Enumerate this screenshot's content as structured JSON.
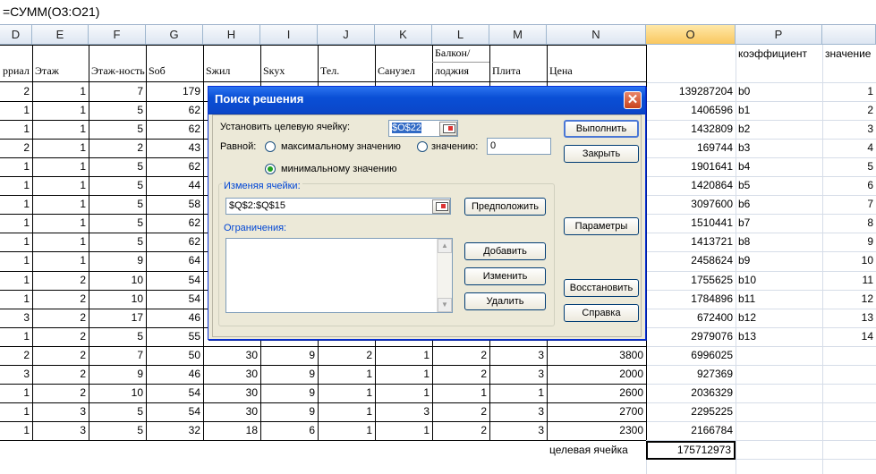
{
  "formula_bar": {
    "text": "=СУММ(O3:O21)"
  },
  "column_headers": [
    "D",
    "E",
    "F",
    "G",
    "H",
    "I",
    "J",
    "K",
    "L",
    "M",
    "N",
    "O",
    "P",
    ""
  ],
  "row1": {
    "D": "рриал с",
    "E": "Этаж",
    "F": "Этаж-ность",
    "G": "Sоб",
    "H": "Sжил",
    "I": "Sкух",
    "J": "Тел.",
    "K": "Санузел",
    "L1": "Балкон/",
    "L2": "лоджия",
    "M": "Плита",
    "N": "Цена",
    "P": "коэффициент",
    "Q": "значение"
  },
  "rows": [
    {
      "D": "2",
      "E": "1",
      "F": "7",
      "G": "179",
      "O": "139287204",
      "P": "b0",
      "Q": "1"
    },
    {
      "D": "1",
      "E": "1",
      "F": "5",
      "G": "62",
      "O": "1406596",
      "P": "b1",
      "Q": "2"
    },
    {
      "D": "1",
      "E": "1",
      "F": "5",
      "G": "62",
      "O": "1432809",
      "P": "b2",
      "Q": "3"
    },
    {
      "D": "2",
      "E": "1",
      "F": "2",
      "G": "43",
      "O": "169744",
      "P": "b3",
      "Q": "4"
    },
    {
      "D": "1",
      "E": "1",
      "F": "5",
      "G": "62",
      "O": "1901641",
      "P": "b4",
      "Q": "5"
    },
    {
      "D": "1",
      "E": "1",
      "F": "5",
      "G": "44",
      "O": "1420864",
      "P": "b5",
      "Q": "6"
    },
    {
      "D": "1",
      "E": "1",
      "F": "5",
      "G": "58",
      "O": "3097600",
      "P": "b6",
      "Q": "7"
    },
    {
      "D": "1",
      "E": "1",
      "F": "5",
      "G": "62",
      "O": "1510441",
      "P": "b7",
      "Q": "8"
    },
    {
      "D": "1",
      "E": "1",
      "F": "5",
      "G": "62",
      "O": "1413721",
      "P": "b8",
      "Q": "9"
    },
    {
      "D": "1",
      "E": "1",
      "F": "9",
      "G": "64",
      "O": "2458624",
      "P": "b9",
      "Q": "10"
    },
    {
      "D": "1",
      "E": "2",
      "F": "10",
      "G": "54",
      "O": "1755625",
      "P": "b10",
      "Q": "11"
    },
    {
      "D": "1",
      "E": "2",
      "F": "10",
      "G": "54",
      "O": "1784896",
      "P": "b11",
      "Q": "12"
    },
    {
      "D": "3",
      "E": "2",
      "F": "17",
      "G": "46",
      "O": "672400",
      "P": "b12",
      "Q": "13"
    },
    {
      "D": "1",
      "E": "2",
      "F": "5",
      "G": "55",
      "O": "2979076",
      "P": "b13",
      "Q": "14"
    },
    {
      "D": "2",
      "E": "2",
      "F": "7",
      "G": "50",
      "H": "30",
      "I": "9",
      "J": "2",
      "K": "1",
      "L": "2",
      "M": "3",
      "N": "3800",
      "O": "6996025"
    },
    {
      "D": "3",
      "E": "2",
      "F": "9",
      "G": "46",
      "H": "30",
      "I": "9",
      "J": "1",
      "K": "1",
      "L": "2",
      "M": "3",
      "N": "2000",
      "O": "927369"
    },
    {
      "D": "1",
      "E": "2",
      "F": "10",
      "G": "54",
      "H": "30",
      "I": "9",
      "J": "1",
      "K": "1",
      "L": "1",
      "M": "1",
      "N": "2600",
      "O": "2036329"
    },
    {
      "D": "1",
      "E": "3",
      "F": "5",
      "G": "54",
      "H": "30",
      "I": "9",
      "J": "1",
      "K": "3",
      "L": "2",
      "M": "3",
      "N": "2700",
      "O": "2295225"
    },
    {
      "D": "1",
      "E": "3",
      "F": "5",
      "G": "32",
      "H": "18",
      "I": "6",
      "J": "1",
      "K": "1",
      "L": "2",
      "M": "3",
      "N": "2300",
      "O": "2166784"
    }
  ],
  "target_row": {
    "label": "целевая ячейка",
    "value": "175712973"
  },
  "dialog": {
    "title": "Поиск решения",
    "close_glyph": "✕",
    "target_cell_label": "Установить целевую ячейку:",
    "target_cell_value": "$O$22",
    "equal_label": "Равной:",
    "radio_max": "максимальному значению",
    "radio_value": "значению:",
    "value_field": "0",
    "radio_min": "минимальному значению",
    "selected_radio": "min",
    "changing_cells_label": "Изменяя ячейки:",
    "changing_cells_value": "$Q$2:$Q$15",
    "constraints_label": "Ограничения:",
    "btn_run": "Выполнить",
    "btn_close": "Закрыть",
    "btn_guess": "Предположить",
    "btn_options": "Параметры",
    "btn_add": "Добавить",
    "btn_change": "Изменить",
    "btn_delete": "Удалить",
    "btn_reset": "Восстановить",
    "btn_help": "Справка",
    "scroll_up": "▲",
    "scroll_down": "▼"
  },
  "colors": {
    "accent": "#0a4fd6",
    "selected_header": "#f9c75f",
    "label_blue": "#0046d5"
  }
}
